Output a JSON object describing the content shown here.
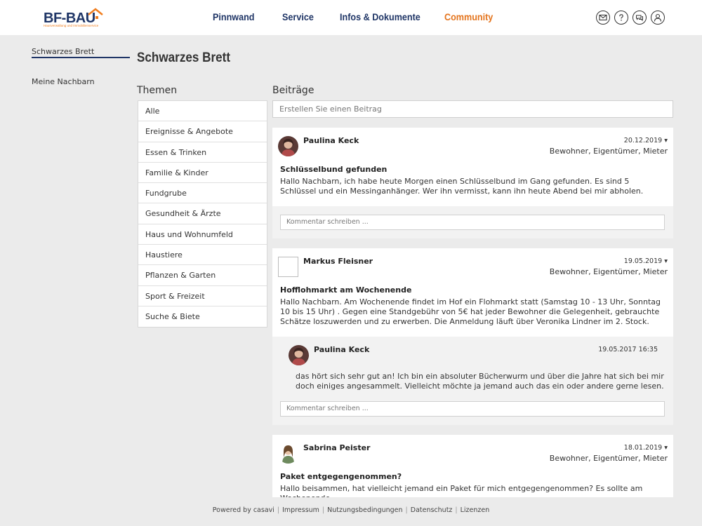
{
  "logo": {
    "main": "BF-BAU",
    "sub": "Hausverwaltung und Immobilienservice"
  },
  "nav": [
    "Pinnwand",
    "Service",
    "Infos & Dokumente",
    "Community"
  ],
  "sidebar": {
    "items": [
      "Schwarzes Brett",
      "Meine Nachbarn"
    ]
  },
  "page_title": "Schwarzes Brett",
  "topics": {
    "heading": "Themen",
    "items": [
      "Alle",
      "Ereignisse & Angebote",
      "Essen & Trinken",
      "Familie & Kinder",
      "Fundgrube",
      "Gesundheit & Ärzte",
      "Haus und Wohnumfeld",
      "Haustiere",
      "Pflanzen & Garten",
      "Sport & Freizeit",
      "Suche & Biete"
    ]
  },
  "posts": {
    "heading": "Beiträge",
    "new_placeholder": "Erstellen Sie einen Beitrag",
    "comment_placeholder": "Kommentar schreiben ...",
    "items": [
      {
        "author": "Paulina Keck",
        "date": "20.12.2019",
        "roles": "Bewohner, Eigentümer, Mieter",
        "title": "Schlüsselbund gefunden",
        "text": "Hallo Nachbarn, ich habe heute Morgen einen Schlüsselbund im Gang gefunden. Es sind 5 Schlüssel und ein Messinganhänger. Wer ihn vermisst, kann ihn heute Abend bei mir abholen."
      },
      {
        "author": "Markus Fleisner",
        "date": "19.05.2019",
        "roles": "Bewohner, Eigentümer, Mieter",
        "title": "Hofflohmarkt am Wochenende",
        "text": "Hallo Nachbarn. Am Wochenende findet im Hof ein Flohmarkt statt (Samstag 10 - 13 Uhr, Sonntag 10 bis 15 Uhr) . Gegen eine Standgebühr von 5€ hat jeder Bewohner die Gelegenheit, gebrauchte Schätze loszuwerden und zu erwerben. Die Anmeldung läuft über Veronika Lindner im 2. Stock.",
        "reply": {
          "author": "Paulina Keck",
          "date": "19.05.2017 16:35",
          "text": "das hört sich sehr gut an! Ich bin ein absoluter Bücherwurm und über die Jahre hat sich bei mir doch einiges angesammelt. Vielleicht möchte ja jemand auch das ein oder andere gerne lesen."
        }
      },
      {
        "author": "Sabrina Peister",
        "date": "18.01.2019",
        "roles": "Bewohner, Eigentümer, Mieter",
        "title": "Paket entgegengenommen?",
        "text": "Hallo beisammen, hat vielleicht jemand ein Paket für mich entgegengenommen? Es sollte am Wochenende"
      }
    ]
  },
  "footer": [
    "Powered by casavi",
    "Impressum",
    "Nutzungsbedingungen",
    "Datenschutz",
    "Lizenzen"
  ],
  "colors": {
    "brand_navy": "#1f3566",
    "brand_orange": "#e4741d"
  }
}
